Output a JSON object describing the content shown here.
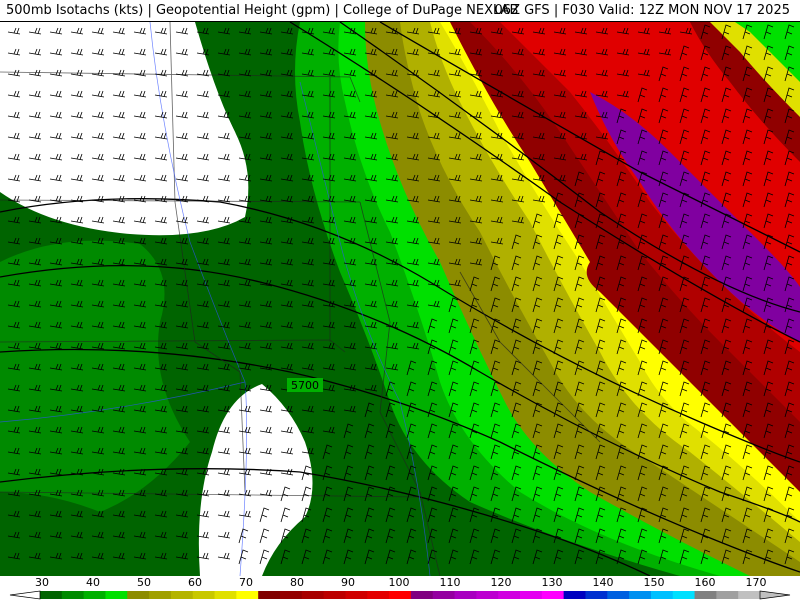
{
  "header": {
    "left": "500mb Isotachs (kts) | Geopotential Height (gpm) | College of DuPage NEXLAB",
    "right": "06Z GFS | F030 Valid: 12Z MON NOV 17 2025"
  },
  "map": {
    "contour_label": "5700",
    "colors": {
      "calm": "#ffffff",
      "g30": "#006400",
      "g35": "#008a00",
      "g40": "#00b000",
      "g45": "#00e000",
      "o50": "#8c8c00",
      "o55": "#b0b000",
      "y60": "#e0e000",
      "y65": "#ffff00",
      "r70": "#900000",
      "r75": "#b00000",
      "r80": "#e00000",
      "p90": "#8000a0"
    }
  },
  "legend": {
    "labels": [
      "30",
      "40",
      "50",
      "60",
      "70",
      "80",
      "90",
      "100",
      "110",
      "120",
      "130",
      "140",
      "150",
      "160",
      "170"
    ],
    "colors": [
      "#006400",
      "#008a00",
      "#00b000",
      "#00e000",
      "#8c8c00",
      "#a0a000",
      "#b4b400",
      "#c8c800",
      "#e0e000",
      "#ffff00",
      "#800000",
      "#940000",
      "#a80000",
      "#bc0000",
      "#d00000",
      "#e40000",
      "#ff0000",
      "#800080",
      "#9400a0",
      "#a800c0",
      "#bc00d0",
      "#d000e0",
      "#e400f0",
      "#ff00ff",
      "#0000c0",
      "#0030d0",
      "#0060e0",
      "#0090f0",
      "#00c0ff",
      "#00e0ff",
      "#808080",
      "#a0a0a0",
      "#c0c0c0"
    ]
  }
}
